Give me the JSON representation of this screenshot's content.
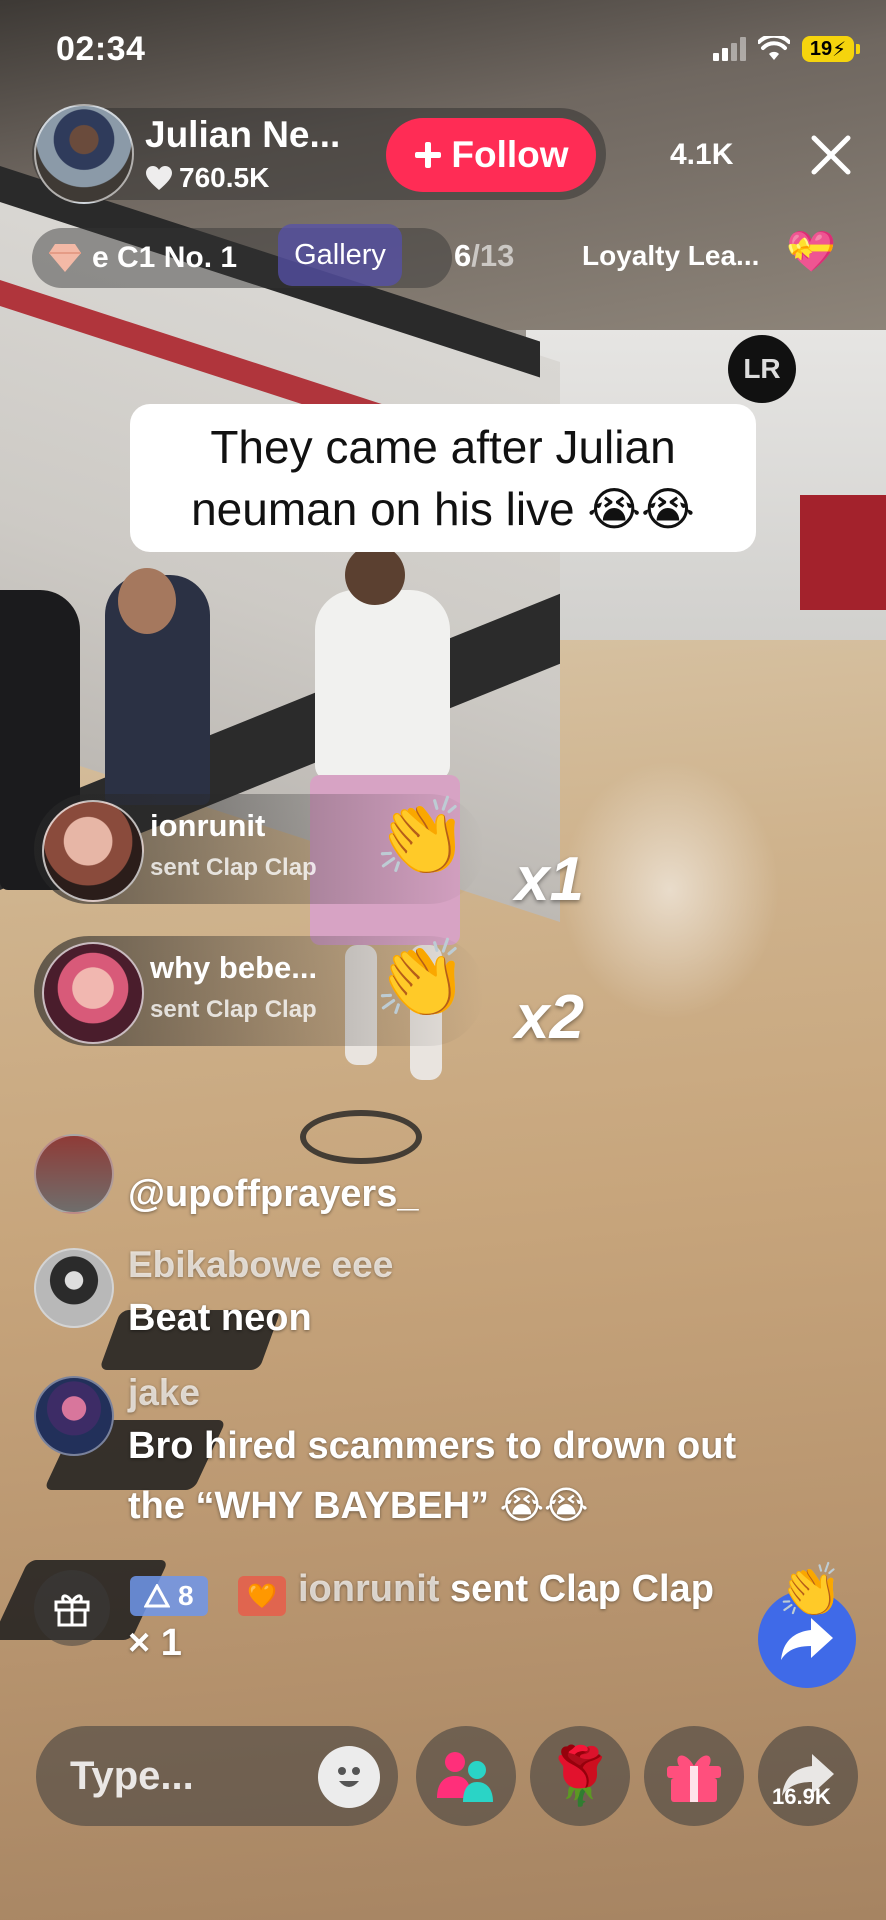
{
  "status_bar": {
    "time": "02:34",
    "battery": "19"
  },
  "header": {
    "host_name": "Julian Ne...",
    "host_likes": "760.5K",
    "follow_label": "Follow",
    "viewer_count": "4.1K"
  },
  "sub_bar": {
    "rank_label": "e C1 No. 1",
    "gallery_label": "Gallery",
    "gallery_current": "6",
    "gallery_total": "/13",
    "loyalty_label": "Loyalty Lea..."
  },
  "caption": "They came after Julian neuman on his live 😭😭",
  "gift_banners": [
    {
      "user": "ionrunit",
      "action": "sent Clap Clap",
      "emoji": "👏",
      "count": "x1"
    },
    {
      "user": "why bebe...",
      "action": "sent Clap Clap",
      "emoji": "👏",
      "count": "x2"
    }
  ],
  "chat": [
    {
      "user": "",
      "text": "@upoffprayers_"
    },
    {
      "user": "Ebikabowe eee",
      "text": "Beat neon"
    },
    {
      "user": "jake",
      "text_line1": "Bro hired scammers to drown out",
      "text_line2": "the “WHY BAYBEH” 😭😭"
    }
  ],
  "system_message": {
    "level": "8",
    "user": "ionrunit",
    "action": " sent Clap Clap",
    "emoji": "👏",
    "count": "× 1"
  },
  "bottom_bar": {
    "input_placeholder": "Type...",
    "share_count": "16.9K",
    "rose_emoji": "🌹"
  },
  "colors": {
    "follow": "#ff2c55",
    "gallery": "#5650aa",
    "share_fab": "#3f6ae8",
    "level_badge": "#6e96eb"
  }
}
